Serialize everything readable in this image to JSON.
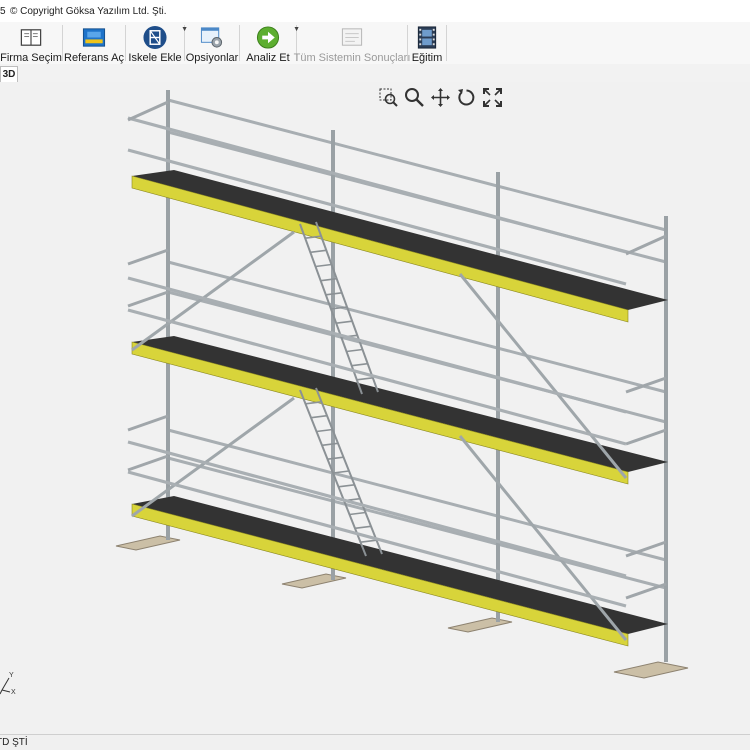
{
  "title_bar": {
    "version_fragment": "5",
    "copyright": "© Copyright Göksa Yazılım Ltd. Şti."
  },
  "toolbar": {
    "buttons": [
      {
        "label": "Firma Seçim",
        "icon": "book-icon"
      },
      {
        "label": "Referans Aç",
        "icon": "reference-open-icon"
      },
      {
        "label": "Iskele Ekle",
        "icon": "scaffold-add-icon"
      },
      {
        "label": "Opsiyonlar",
        "icon": "options-icon"
      },
      {
        "label": "Analiz Et",
        "icon": "analyze-arrow-icon"
      },
      {
        "label": "Tüm Sistemin Sonuçları",
        "icon": "results-icon",
        "disabled": true
      },
      {
        "label": "Eğitim",
        "icon": "film-icon"
      }
    ]
  },
  "tabs": {
    "active": "3D"
  },
  "viewport": {
    "background": "#f1f1f1",
    "view_tools": [
      "zoom-window-icon",
      "zoom-icon",
      "pan-icon",
      "rotate-icon",
      "fit-icon"
    ],
    "axis_labels": {
      "y": "Y",
      "x": "X"
    }
  },
  "status_bar": {
    "text": "TD ŞTİ"
  },
  "colors": {
    "deck_yellow": "#d8d43a",
    "deck_dark": "#2f2f2f",
    "tube": "#9ea4a8",
    "base_plank": "#c9bda6"
  }
}
